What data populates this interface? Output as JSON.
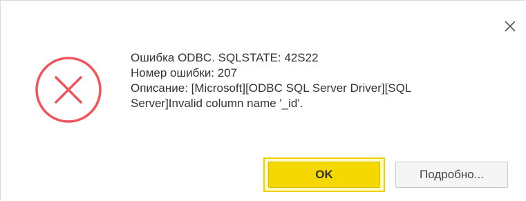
{
  "dialog": {
    "close_icon": "close-icon",
    "error_icon": "error-circle-x-icon",
    "error_color": "#f0545c",
    "message_lines": [
      "Ошибка ODBC. SQLSTATE: 42S22",
      "Номер ошибки: 207",
      "Описание: [Microsoft][ODBC SQL Server Driver][SQL",
      "Server]Invalid column name '_id'."
    ],
    "ok_label": "OK",
    "details_label": "Подробно...",
    "accent_color": "#f4d800"
  }
}
